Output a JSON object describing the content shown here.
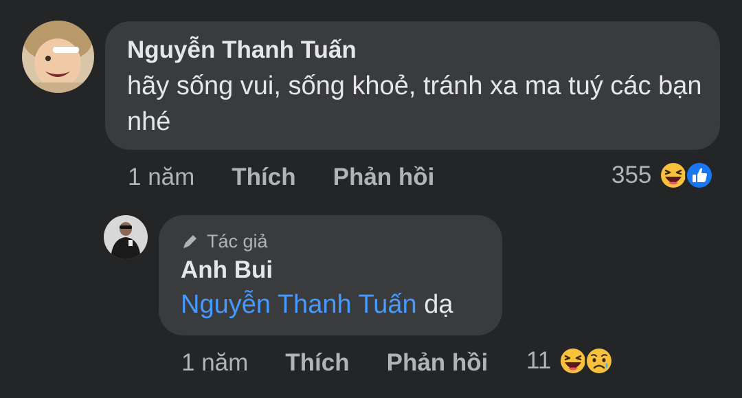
{
  "comment": {
    "author": "Nguyễn Thanh Tuấn",
    "text": "hãy sống vui, sống khoẻ, tránh xa ma tuý các bạn nhé",
    "time": "1 năm",
    "like_label": "Thích",
    "reply_label": "Phản hồi",
    "reaction_count": "355",
    "reactions": [
      "haha-icon",
      "like-icon"
    ]
  },
  "reply": {
    "role": "Tác giả",
    "role_icon": "pencil-icon",
    "author": "Anh Bui",
    "mention": "Nguyễn Thanh Tuấn",
    "text": "dạ",
    "time": "1 năm",
    "like_label": "Thích",
    "reply_label": "Phản hồi",
    "reaction_count": "11",
    "reactions": [
      "haha-icon",
      "sad-icon"
    ]
  },
  "colors": {
    "background": "#242526",
    "bubble": "#3a3b3c",
    "primary_text": "#e4e6eb",
    "secondary_text": "#b0b3b8",
    "mention": "#4599ff",
    "like_blue": "#1877f2",
    "emoji_yellow": "#f7c13e"
  }
}
